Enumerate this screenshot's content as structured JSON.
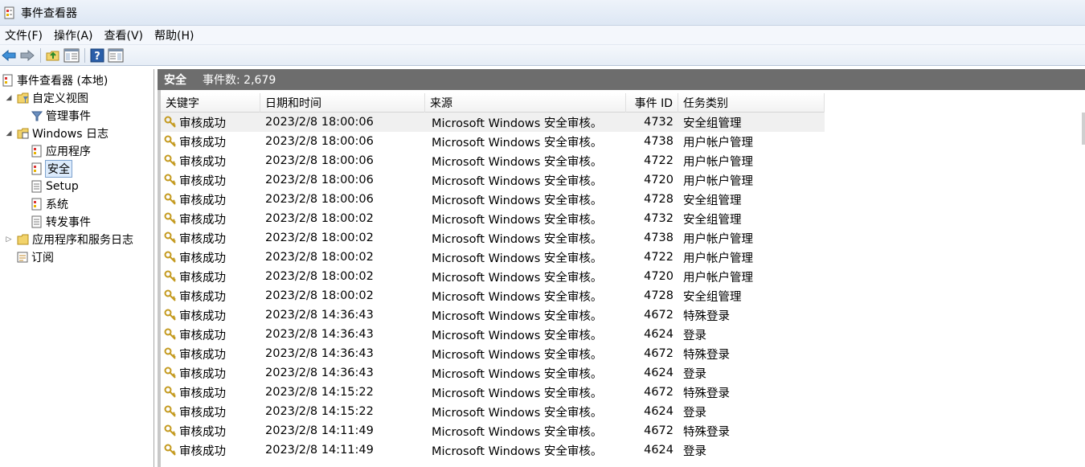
{
  "window": {
    "title": "事件查看器"
  },
  "menu": [
    "文件(F)",
    "操作(A)",
    "查看(V)",
    "帮助(H)"
  ],
  "toolbar": {
    "icons": [
      "back-arrow-icon",
      "forward-arrow-icon",
      "up-folder-icon",
      "show-hide-tree-icon",
      "help-icon",
      "show-hide-action-pane-icon"
    ]
  },
  "tree": {
    "root": "事件查看器 (本地)",
    "custom_views": "自定义视图",
    "admin_events": "管理事件",
    "windows_logs": "Windows 日志",
    "application": "应用程序",
    "security": "安全",
    "setup": "Setup",
    "system": "系统",
    "forwarded": "转发事件",
    "app_service_logs": "应用程序和服务日志",
    "subscriptions": "订阅"
  },
  "main": {
    "title": "安全",
    "event_count": "事件数: 2,679",
    "columns": [
      "关键字",
      "日期和时间",
      "来源",
      "事件 ID",
      "任务类别"
    ],
    "rows": [
      [
        "审核成功",
        "2023/2/8 18:00:06",
        "Microsoft Windows 安全审核。",
        "4732",
        "安全组管理"
      ],
      [
        "审核成功",
        "2023/2/8 18:00:06",
        "Microsoft Windows 安全审核。",
        "4738",
        "用户帐户管理"
      ],
      [
        "审核成功",
        "2023/2/8 18:00:06",
        "Microsoft Windows 安全审核。",
        "4722",
        "用户帐户管理"
      ],
      [
        "审核成功",
        "2023/2/8 18:00:06",
        "Microsoft Windows 安全审核。",
        "4720",
        "用户帐户管理"
      ],
      [
        "审核成功",
        "2023/2/8 18:00:06",
        "Microsoft Windows 安全审核。",
        "4728",
        "安全组管理"
      ],
      [
        "审核成功",
        "2023/2/8 18:00:02",
        "Microsoft Windows 安全审核。",
        "4732",
        "安全组管理"
      ],
      [
        "审核成功",
        "2023/2/8 18:00:02",
        "Microsoft Windows 安全审核。",
        "4738",
        "用户帐户管理"
      ],
      [
        "审核成功",
        "2023/2/8 18:00:02",
        "Microsoft Windows 安全审核。",
        "4722",
        "用户帐户管理"
      ],
      [
        "审核成功",
        "2023/2/8 18:00:02",
        "Microsoft Windows 安全审核。",
        "4720",
        "用户帐户管理"
      ],
      [
        "审核成功",
        "2023/2/8 18:00:02",
        "Microsoft Windows 安全审核。",
        "4728",
        "安全组管理"
      ],
      [
        "审核成功",
        "2023/2/8 14:36:43",
        "Microsoft Windows 安全审核。",
        "4672",
        "特殊登录"
      ],
      [
        "审核成功",
        "2023/2/8 14:36:43",
        "Microsoft Windows 安全审核。",
        "4624",
        "登录"
      ],
      [
        "审核成功",
        "2023/2/8 14:36:43",
        "Microsoft Windows 安全审核。",
        "4672",
        "特殊登录"
      ],
      [
        "审核成功",
        "2023/2/8 14:36:43",
        "Microsoft Windows 安全审核。",
        "4624",
        "登录"
      ],
      [
        "审核成功",
        "2023/2/8 14:15:22",
        "Microsoft Windows 安全审核。",
        "4672",
        "特殊登录"
      ],
      [
        "审核成功",
        "2023/2/8 14:15:22",
        "Microsoft Windows 安全审核。",
        "4624",
        "登录"
      ],
      [
        "审核成功",
        "2023/2/8 14:11:49",
        "Microsoft Windows 安全审核。",
        "4672",
        "特殊登录"
      ],
      [
        "审核成功",
        "2023/2/8 14:11:49",
        "Microsoft Windows 安全审核。",
        "4624",
        "登录"
      ]
    ]
  }
}
